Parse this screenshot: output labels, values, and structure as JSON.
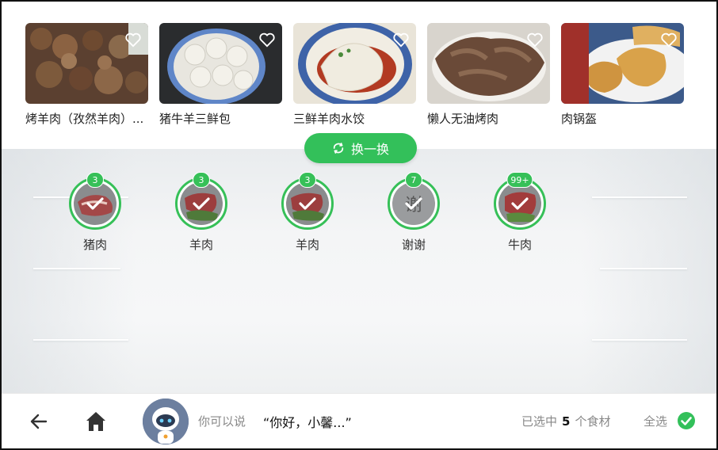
{
  "recipes": [
    {
      "name": "烤羊肉（孜然羊肉）...",
      "icon": "heart-outline-icon"
    },
    {
      "name": "猪牛羊三鲜包",
      "icon": "heart-outline-icon"
    },
    {
      "name": "三鲜羊肉水饺",
      "icon": "heart-outline-icon"
    },
    {
      "name": "懒人无油烤肉",
      "icon": "heart-outline-icon"
    },
    {
      "name": "肉锅盔",
      "icon": "heart-outline-icon"
    }
  ],
  "refresh": {
    "label": "换一换",
    "icon": "refresh-icon"
  },
  "ingredients": [
    {
      "label": "猪肉",
      "count": "3",
      "selected": true
    },
    {
      "label": "羊肉",
      "count": "3",
      "selected": true
    },
    {
      "label": "羊肉",
      "count": "3",
      "selected": true
    },
    {
      "label": "谢谢",
      "count": "7",
      "selected": true,
      "text_image": "谢"
    },
    {
      "label": "牛肉",
      "count": "99+",
      "selected": true
    }
  ],
  "bottom_bar": {
    "hint_prefix": "你可以说",
    "hint_quote": "“你好，小馨...”",
    "selected_prefix": "已选中",
    "selected_count": "5",
    "selected_suffix": "个食材",
    "select_all": "全选"
  },
  "colors": {
    "accent": "#33c05a",
    "text": "#222222",
    "muted": "#888888"
  }
}
